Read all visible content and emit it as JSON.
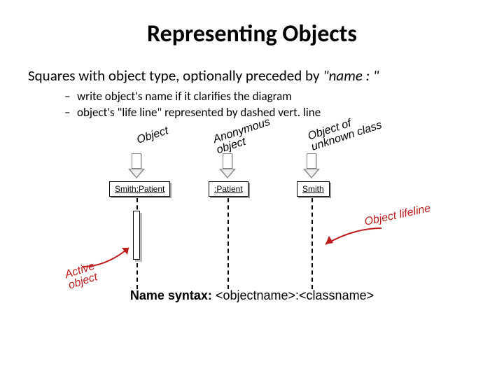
{
  "title": "Representing Objects",
  "intro": {
    "text_prefix": "Squares with object type, optionally preceded by ",
    "quoted": "\"name : \""
  },
  "bullets": [
    "write object's name if it clarifies the diagram",
    "object's \"life line\" represented by dashed vert. line"
  ],
  "diagram": {
    "labels": {
      "object": "Object",
      "anonymous": "Anonymous object",
      "unknown": "Object of unknown class",
      "active": "Active object",
      "lifeline": "Object lifeline"
    },
    "boxes": {
      "box1": "Smith:Patient",
      "box2": ":Patient",
      "box3": "Smith"
    },
    "syntax": {
      "label": "Name syntax:",
      "value": "<objectname>:<classname>"
    }
  }
}
